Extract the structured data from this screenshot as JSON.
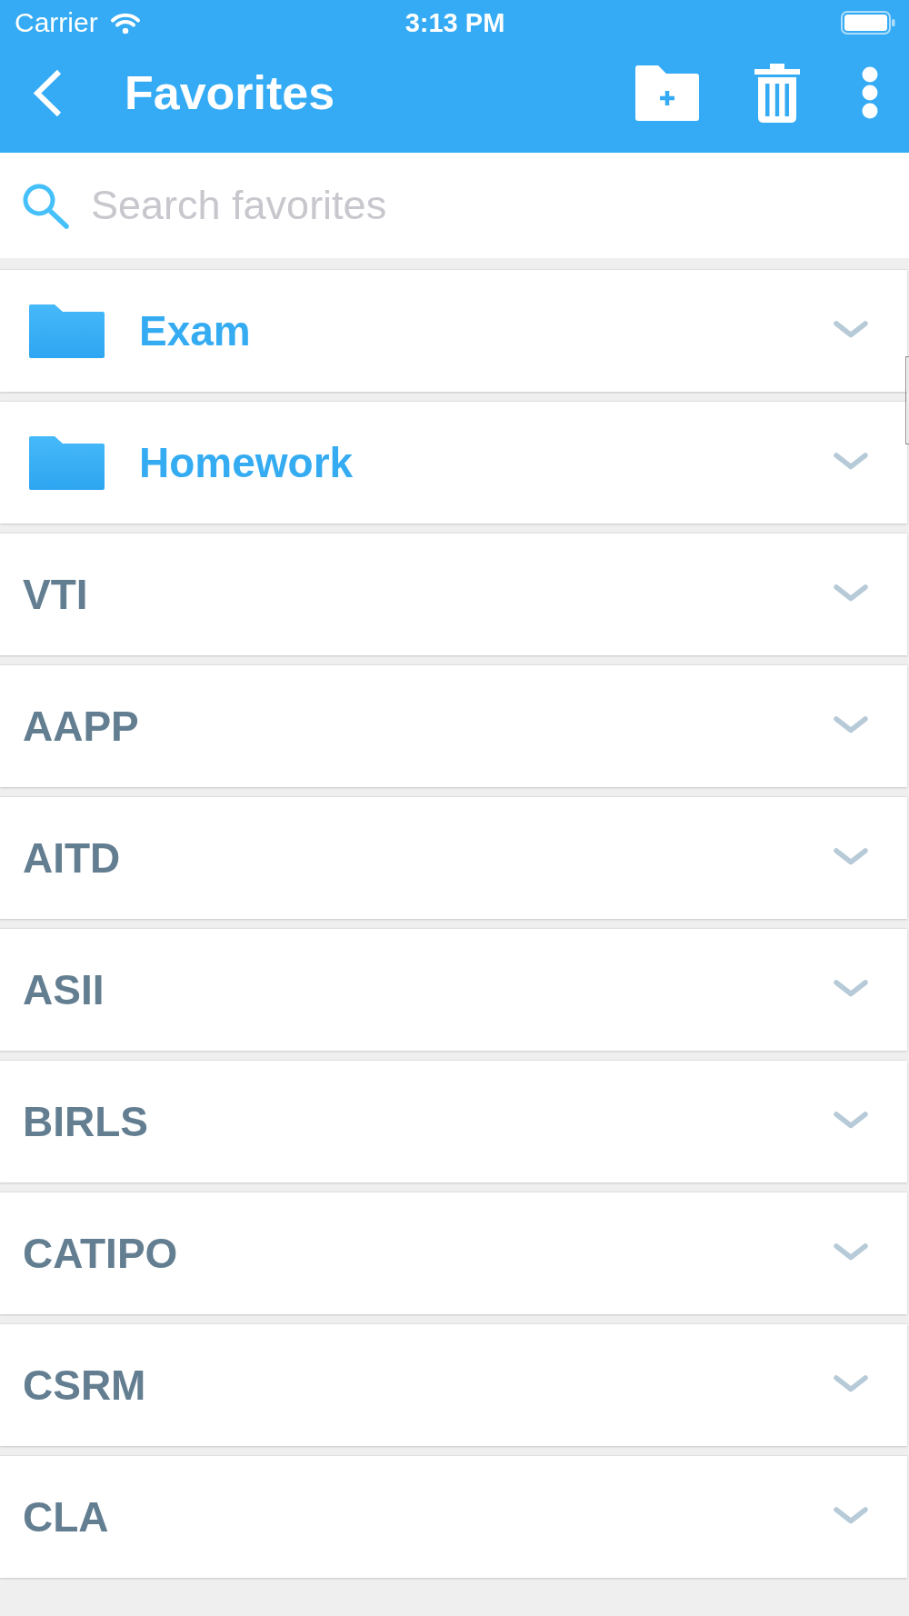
{
  "status_bar": {
    "carrier": "Carrier",
    "time": "3:13 PM"
  },
  "header": {
    "title": "Favorites"
  },
  "search": {
    "placeholder": "Search favorites"
  },
  "items": [
    {
      "kind": "folder",
      "label": "Exam",
      "expanded": false
    },
    {
      "kind": "folder",
      "label": "Homework",
      "expanded": false
    },
    {
      "kind": "group",
      "label": "VTI",
      "expanded": false
    },
    {
      "kind": "group",
      "label": "AAPP",
      "expanded": false
    },
    {
      "kind": "group",
      "label": "AITD",
      "expanded": false
    },
    {
      "kind": "group",
      "label": "ASII",
      "expanded": false
    },
    {
      "kind": "group",
      "label": "BIRLS",
      "expanded": false
    },
    {
      "kind": "group",
      "label": "CATIPO",
      "expanded": false
    },
    {
      "kind": "group",
      "label": "CSRM",
      "expanded": false
    },
    {
      "kind": "group",
      "label": "CLA",
      "expanded": false
    }
  ]
}
